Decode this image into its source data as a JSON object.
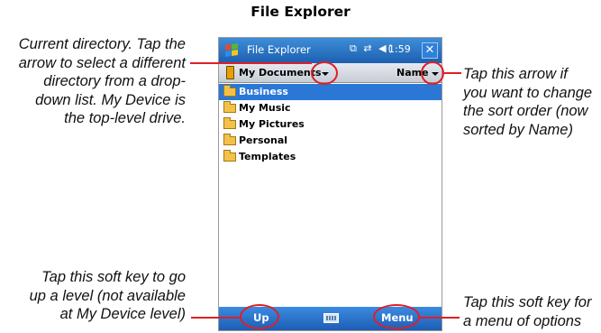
{
  "page": {
    "title": "File Explorer"
  },
  "window": {
    "title": "File Explorer",
    "status_icons": "⧉ ⇄ ◀(",
    "time": "1:59",
    "close_label": "✕"
  },
  "directory_bar": {
    "current_directory": "My Documents",
    "sort_by": "Name"
  },
  "folders": [
    {
      "name": "Business",
      "selected": true
    },
    {
      "name": "My Music",
      "selected": false
    },
    {
      "name": "My Pictures",
      "selected": false
    },
    {
      "name": "Personal",
      "selected": false
    },
    {
      "name": "Templates",
      "selected": false
    }
  ],
  "softkeys": {
    "left": "Up",
    "right": "Menu"
  },
  "annotations": {
    "directory": [
      "Current directory. Tap the",
      "arrow to select a different",
      "directory from a drop-",
      "down list. My Device is",
      "the top-level drive."
    ],
    "sort": [
      "Tap this arrow if",
      "you want to change",
      "the sort order (now",
      "sorted by Name)"
    ],
    "up_key": [
      "Tap this soft key to go",
      "up a level (not available",
      "at My Device level)"
    ],
    "menu_key": [
      "Tap this soft key for",
      "a menu of options"
    ]
  },
  "colors": {
    "highlight": "#e01f25",
    "title_bar": "#1c5fb0",
    "selection": "#2a77d6"
  }
}
